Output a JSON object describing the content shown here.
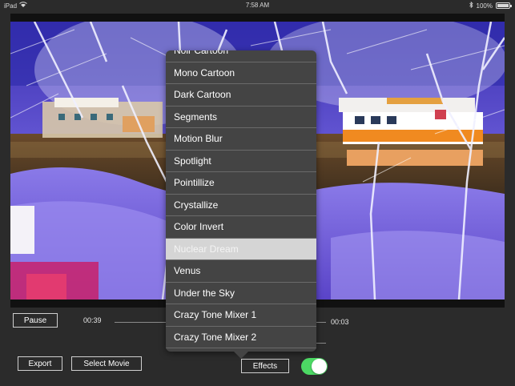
{
  "status_bar": {
    "device": "iPad",
    "time": "7:58 AM",
    "battery_text": "100%",
    "battery_level": 1.0
  },
  "player": {
    "pause_label": "Pause",
    "elapsed": "00:39",
    "remaining": "00:03",
    "export_label": "Export",
    "select_movie_label": "Select Movie",
    "effects_label": "Effects",
    "toggle_on": true,
    "toggle_color": "#4cd964"
  },
  "effects_menu": {
    "selected": "Nuclear Dream",
    "items": [
      "Noir Cartoon",
      "Mono Cartoon",
      "Dark Cartoon",
      "Segments",
      "Motion Blur",
      "Spotlight",
      "Pointillize",
      "Crystallize",
      "Color Invert",
      "Nuclear Dream",
      "Venus",
      "Under the Sky",
      "Crazy Tone Mixer 1",
      "Crazy Tone Mixer 2"
    ]
  }
}
